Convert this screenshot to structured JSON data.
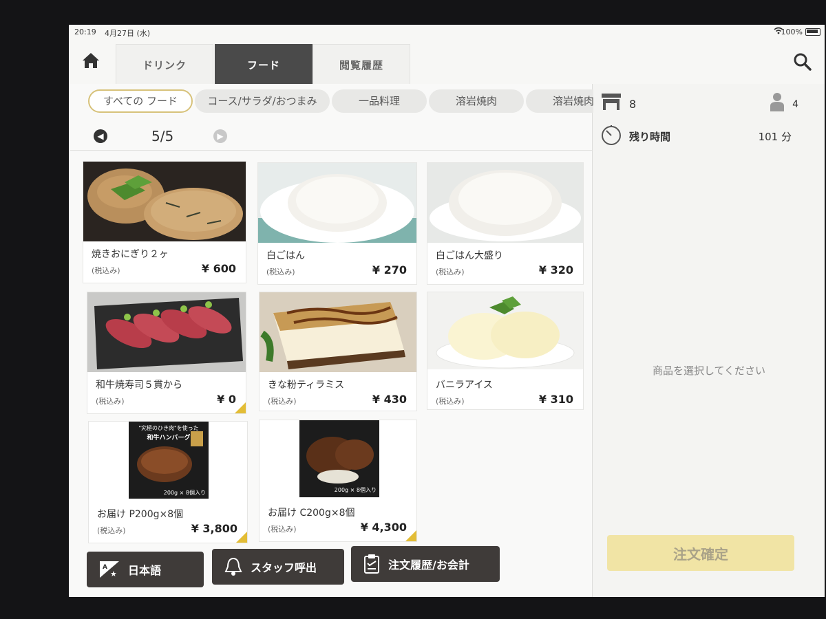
{
  "status_bar": {
    "time": "20:19",
    "date": "4月27日 (水)",
    "battery": "100%"
  },
  "tabs": [
    {
      "label": "ドリンク"
    },
    {
      "label": "フード"
    },
    {
      "label": "閲覧履歴"
    }
  ],
  "categories": [
    {
      "label": "すべての フード"
    },
    {
      "label": "コース/サラダ/おつまみ"
    },
    {
      "label": "一品料理"
    },
    {
      "label": "溶岩焼肉"
    },
    {
      "label": "溶岩焼肉"
    }
  ],
  "pager": {
    "page": "5/5"
  },
  "products": [
    {
      "name": "焼きおにぎり２ヶ",
      "tax": "(税込み)",
      "price": "¥ 600"
    },
    {
      "name": "白ごはん",
      "tax": "(税込み)",
      "price": "¥ 270"
    },
    {
      "name": "白ごはん大盛り",
      "tax": "(税込み)",
      "price": "¥ 320"
    },
    {
      "name": "和牛焼寿司５貫から",
      "tax": "(税込み)",
      "price": "¥ 0"
    },
    {
      "name": "きな粉ティラミス",
      "tax": "(税込み)",
      "price": "¥ 430"
    },
    {
      "name": "バニラアイス",
      "tax": "(税込み)",
      "price": "¥ 310"
    },
    {
      "name": "お届け P200g×8個",
      "tax": "(税込み)",
      "price": "¥ 3,800"
    },
    {
      "name": "お届け C200g×8個",
      "tax": "(税込み)",
      "price": "¥ 4,300"
    }
  ],
  "package_text": {
    "title": "\"究極のひき肉\"を使った",
    "subtitle": "和牛ハンバーグ",
    "spec": "200g × 8個入り"
  },
  "bottom_buttons": {
    "language": "日本語",
    "staff_call": "スタッフ呼出",
    "history": "注文履歴/お会計"
  },
  "side_panel": {
    "table_number": "8",
    "guests": "4",
    "remaining_label": "残り時間",
    "remaining_value": "101 分",
    "empty_message": "商品を選択してください",
    "confirm_label": "注文確定"
  },
  "colors": {
    "active_tab": "#4a4a4a",
    "accent_gold": "#e3bd36",
    "confirm_bg": "#f1e4a5",
    "button_dark": "#3f3b39"
  }
}
